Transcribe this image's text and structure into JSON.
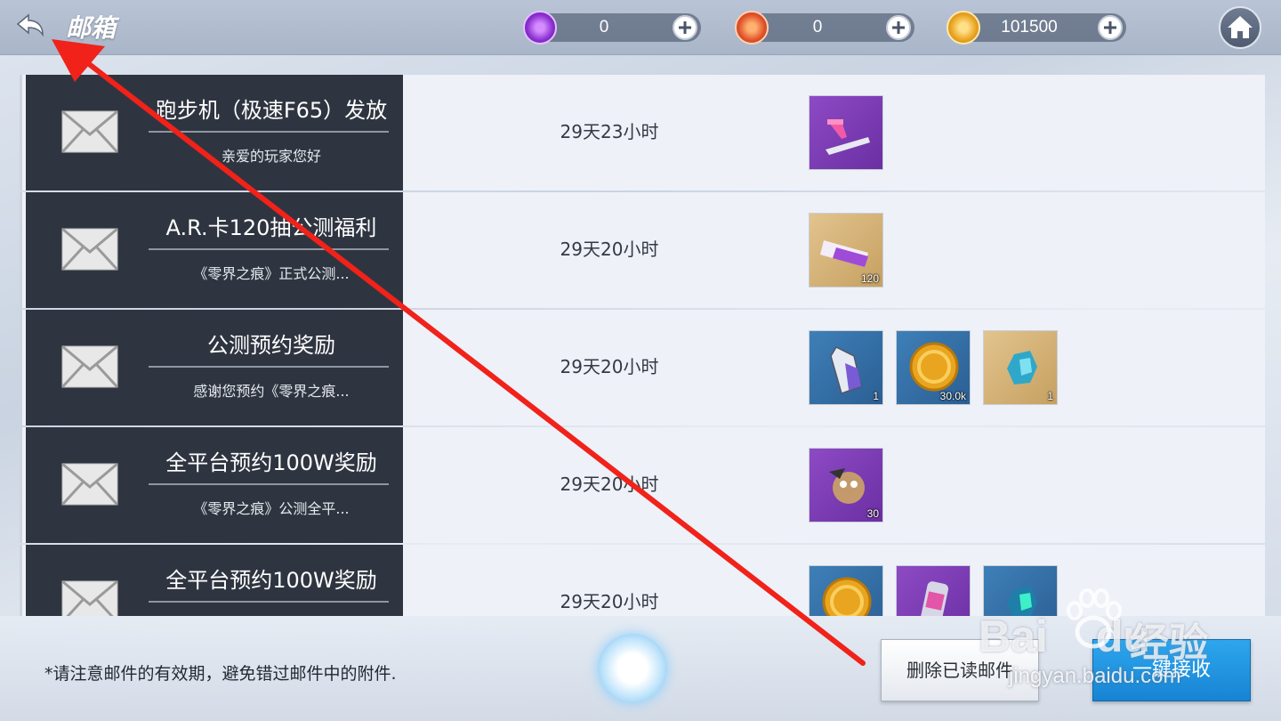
{
  "header": {
    "title": "邮箱",
    "currencies": [
      {
        "name": "purple-crystal",
        "value": "0",
        "color": "#9b3fd8"
      },
      {
        "name": "red-flame",
        "value": "0",
        "color": "#e0522a"
      },
      {
        "name": "gold-coin",
        "value": "101500",
        "color": "#e8a31e"
      }
    ]
  },
  "mails": [
    {
      "title": "跑步机（极速F65）发放",
      "subtitle": "亲爱的玩家您好",
      "time": "29天23小时",
      "attachments": [
        {
          "icon": "treadmill-icon",
          "bg": "purple",
          "qty": ""
        }
      ]
    },
    {
      "title": "A.R.卡120抽公测福利",
      "subtitle": "《零界之痕》正式公测...",
      "time": "29天20小时",
      "attachments": [
        {
          "icon": "ar-card-icon",
          "bg": "gold",
          "qty": "120"
        }
      ]
    },
    {
      "title": "公测预约奖励",
      "subtitle": "感谢您预约《零界之痕...",
      "time": "29天20小时",
      "attachments": [
        {
          "icon": "battery-icon",
          "bg": "blue",
          "qty": "1"
        },
        {
          "icon": "gold-coin-icon",
          "bg": "blue",
          "qty": "30.0k"
        },
        {
          "icon": "mech-part-icon",
          "bg": "gold",
          "qty": "1"
        }
      ]
    },
    {
      "title": "全平台预约100W奖励",
      "subtitle": "《零界之痕》公测全平...",
      "time": "29天20小时",
      "attachments": [
        {
          "icon": "mascot-icon",
          "bg": "purple",
          "qty": "30"
        }
      ]
    },
    {
      "title": "全平台预约100W奖励",
      "subtitle": "",
      "time": "29天20小时",
      "attachments": [
        {
          "icon": "gold-coin-icon",
          "bg": "blue",
          "qty": ""
        },
        {
          "icon": "canister-icon",
          "bg": "purple",
          "qty": ""
        },
        {
          "icon": "mech-part-icon",
          "bg": "blue",
          "qty": ""
        }
      ]
    }
  ],
  "footer": {
    "notice": "*请注意邮件的有效期，避免错过邮件中的附件.",
    "delete_label": "删除已读邮件",
    "claim_label": "一键接收"
  },
  "watermark": {
    "brand": "Bai",
    "brand2": "du",
    "cn": "经验",
    "url": "jingyan.baidu.com"
  }
}
